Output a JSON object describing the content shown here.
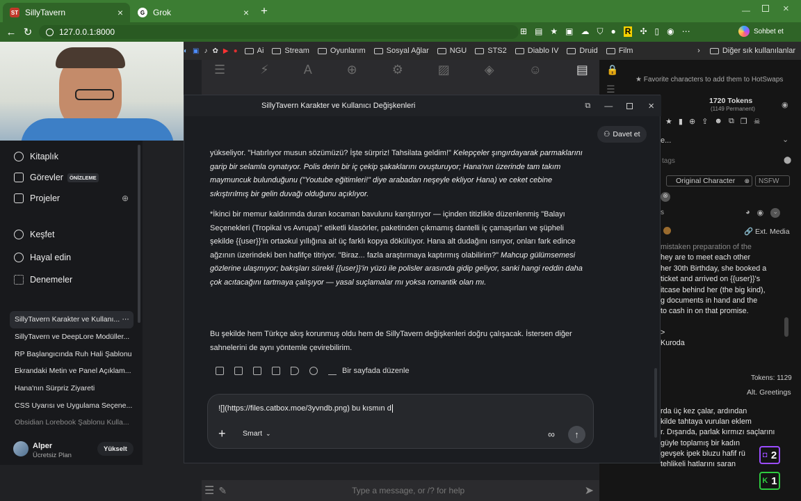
{
  "browser": {
    "tabs": [
      {
        "label": "SillyTavern",
        "icon": "ST"
      },
      {
        "label": "Grok",
        "icon": "G"
      }
    ],
    "url": "127.0.0.1:8000",
    "profile_label": "Sohbet et",
    "bookmarks": [
      "Ai",
      "Stream",
      "Oyunlarım",
      "Sosyal Ağlar",
      "NGU",
      "STS2",
      "Diablo IV",
      "Druid",
      "Film"
    ],
    "other_bookmarks": "Diğer sık kullanılanlar"
  },
  "sillytavern": {
    "hotswap_hint": "Favorite characters to add them to HotSwaps",
    "tokens": "1720 Tokens",
    "permanent": "(1149 Permanent)",
    "tags_placeholder": "tags",
    "tag1": "Original Character",
    "tag2": "NSFW",
    "ext_media": "Ext. Media",
    "desc_lines": [
      "hey are to meet each other",
      "her 30th Birthday, she booked a",
      "ticket and arrived on {{user}}'s",
      "itcase behind her (the big kind),",
      "g documents in hand and the",
      "to cash in on that promise."
    ],
    "misc1": ">",
    "misc2": "Kuroda",
    "tokens2": "Tokens: 1129",
    "alt_greetings": "Alt. Greetings",
    "greet_lines": [
      "rda üç kez çalar, ardından",
      "kilde tahtaya vurulan eklem",
      "r. Dışarıda, parlak kırmızı saçlarını",
      "güyle toplamış bir kadın",
      "gevşek ipek bluzu hafif rü",
      "tehlikeli hatlarını saran"
    ],
    "input_placeholder": "Type a message, or /? for help",
    "badge1": "2",
    "badge2": "1",
    "ellipsis": "e..."
  },
  "grok": {
    "window_title": "SillyTavern Karakter ve Kullanıcı Değişkenleri",
    "invite": "Davet et",
    "nav": [
      {
        "label": "Kitaplık",
        "icon": "library-icon"
      },
      {
        "label": "Görevler",
        "icon": "tasks-icon",
        "badge": "ÖNİZLEME"
      },
      {
        "label": "Projeler",
        "icon": "projects-icon"
      },
      {
        "label": "Keşfet",
        "icon": "explore-icon"
      },
      {
        "label": "Hayal edin",
        "icon": "imagine-icon"
      },
      {
        "label": "Denemeler",
        "icon": "experiments-icon"
      }
    ],
    "chats": [
      "SillyTavern Karakter ve Kullanı...",
      "SillyTavern ve DeepLore Modüller...",
      "RP Başlangıcında Ruh Hali Şablonu",
      "Ekrandaki Metin ve Panel Açıklam...",
      "Hana'nın Sürpriz Ziyareti",
      "CSS Uyarısı ve Uygulama Seçene...",
      "Obsidian Lorebook Şablonu Kulla..."
    ],
    "user_name": "Alper",
    "user_plan": "Ücretsiz Plan",
    "upgrade": "Yükselt",
    "para1": {
      "n1": "yükseliyor. \"Hatırlıyor musun sözümüzü? İşte sürpriz! Tahsilata geldim!\" ",
      "i1": "Kelepçeler şıngırdayarak parmaklarını garip bir selamla oynatıyor. Polis derin bir iç çekip şakaklarını ovuşturuyor; Hana'nın üzerinde tam takım maymuncuk bulunduğunu (\"Youtube eğitimleri!\" diye arabadan neşeyle ekliyor Hana) ve ceket cebine sıkıştırılmış bir gelin duvağı olduğunu açıklıyor."
    },
    "para2": {
      "n1": "*İkinci bir memur kaldırımda duran kocaman bavulunu karıştırıyor — içinden titizlikle düzenlenmiş \"Balayı Seçenekleri (Tropikal vs Avrupa)\" etiketli klasörler, paketinden çıkmamış dantelli iç çamaşırları ve şüpheli şekilde {{user}}'in ortaokul yıllığına ait üç farklı kopya dökülüyor. Hana alt dudağını ısırıyor, onları fark edince ağzının üzerindeki ben hafifçe titriyor. \"Biraz... fazla araştırmaya kaptırmış olabilirim?\" ",
      "i1": "Mahcup gülümsemesi gözlerine ulaşmıyor; bakışları sürekli {{user}}'in yüzü ile polisler arasında gidip geliyor, sanki hangi reddin daha çok acıtacağını tartmaya çalışıyor — yasal suçlamalar mı yoksa romantik olan mı."
    },
    "para3": "Bu şekilde hem Türkçe akış korunmuş oldu hem de SillyTavern değişkenleri doğru çalışacak. İstersen diğer sahnelerini de aynı yöntemle çevirebilirim.",
    "edit_page": "Bir sayfada düzenle",
    "composer_text": "![](https://files.catbox.moe/3yvndb.png) bu kısmın d",
    "model_label": "Smart"
  },
  "colors": {
    "accent": "#3c7d33",
    "grok_bg": "#1b1d21",
    "sidebar_bg": "#18191c"
  }
}
